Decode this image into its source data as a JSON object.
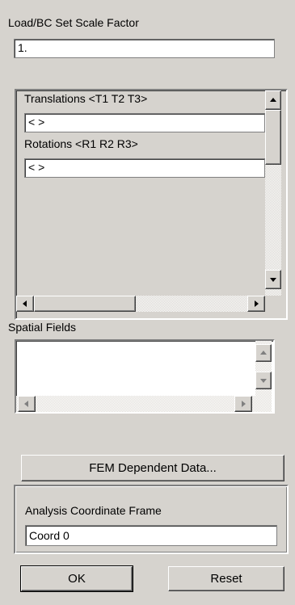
{
  "scale_factor": {
    "label": "Load/BC Set Scale Factor",
    "value": "1."
  },
  "vector_panel": {
    "translations": {
      "label": "Translations <T1 T2 T3>",
      "value": "<   >"
    },
    "rotations": {
      "label": "Rotations <R1 R2 R3>",
      "value": "<   >"
    }
  },
  "spatial_fields": {
    "label": "Spatial Fields",
    "items": []
  },
  "buttons": {
    "fem_dependent": "FEM Dependent Data...",
    "ok": "OK",
    "reset": "Reset"
  },
  "analysis_frame": {
    "label": "Analysis Coordinate Frame",
    "value": "Coord 0"
  },
  "colors": {
    "background": "#d6d3ce",
    "field": "#ffffff",
    "shadow": "#808080"
  }
}
